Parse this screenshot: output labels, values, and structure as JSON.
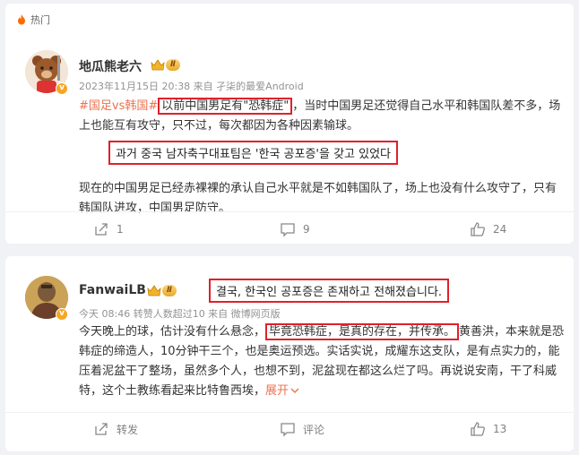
{
  "hot_label": "热门",
  "post1": {
    "username": "地瓜熊老六",
    "level": "Ⅱ",
    "meta": "2023年11月15日 20:38  来自 孑柒的最爱Android",
    "hashtag": "#国足vs韩国#",
    "boxed_quote": "以前中国男足有\"恐韩症\"",
    "text_after_box": "，当时中国男足还觉得自己水平和韩国队差不多，场上也能互有攻守，只不过，每次都因为各种因素输球。",
    "korean_caption": "과거 중국 남자축구대표팀은 '한국 공포증'을 갖고 있었다",
    "text2": "现在的中国男足已经赤裸裸的承认自己水平就是不如韩国队了，场上也没有什么攻守了，只有韩国队进攻，中国男足防守。",
    "share_count": "1",
    "comment_count": "9",
    "like_count": "24"
  },
  "post2": {
    "username": "FanwaiLB",
    "level": "Ⅱ",
    "meta": "今天 08:46  转赞人数超过10  来自 微博网页版",
    "korean_caption": "결국, 한국인 공포증은 존재하고  전해졌습니다.",
    "text_before_box": "今天晚上的球，估计没有什么悬念，",
    "boxed_quote": "毕竟恐韩症，是真的存在，并传承。",
    "text_after_box": "黄善洪，本来就是恐韩症的缔造人，10分钟干三个，也是奥运预选。实话实说，成耀东这支队，是有点实力的，能压着泥盆干了整场，虽然多个人，也想不到，泥盆现在都这么烂了吗。再说说安南，干了科威特，这个土教练看起来比特鲁西埃，",
    "expand_label": "展开",
    "share_label": "转发",
    "comment_label": "评论",
    "like_count": "13"
  }
}
